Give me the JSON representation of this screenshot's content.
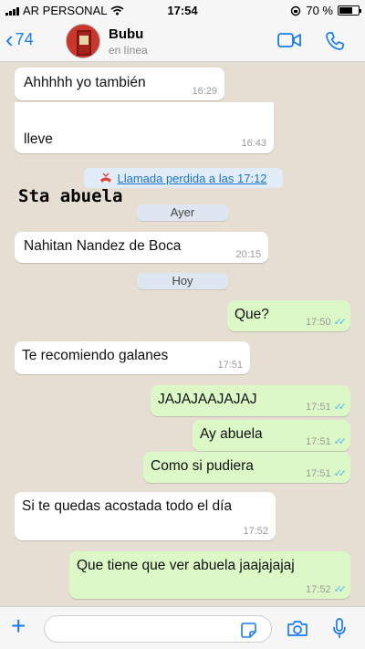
{
  "status_bar": {
    "carrier": "AR PERSONAL",
    "time": "17:54",
    "battery": "70 %",
    "battery_level": 0.7
  },
  "header": {
    "back_count": "74",
    "contact_name": "Bubu",
    "contact_status": "en línea"
  },
  "chat": {
    "overlay_text": "Sta abuela",
    "missed_call": "Llamada perdida a las 17:12",
    "day_yesterday": "Ayer",
    "day_today": "Hoy",
    "messages": [
      {
        "text": "Ahhhhh yo también",
        "time": "16:29"
      },
      {
        "text_line1": "",
        "text_line2": "lleve",
        "time": "16:43"
      },
      {
        "text": "Nahitan Nandez de Boca",
        "time": "20:15"
      },
      {
        "text": "Que?",
        "time": "17:50"
      },
      {
        "text": "Te recomiendo galanes",
        "time": "17:51"
      },
      {
        "text": "JAJAJAAJAJAJ",
        "time": "17:51"
      },
      {
        "text": "Ay abuela",
        "time": "17:51"
      },
      {
        "text": "Como si pudiera",
        "time": "17:51"
      },
      {
        "text": "Si te quedas acostada todo el día",
        "time": "17:52"
      },
      {
        "text": "Que tiene que ver abuela jaajajajaj",
        "time": "17:52"
      }
    ]
  },
  "input": {
    "placeholder": ""
  },
  "icons": [
    "chevron-left-icon",
    "video-icon",
    "phone-icon",
    "plus-icon",
    "sticker-icon",
    "camera-icon",
    "mic-icon",
    "read-ticks-icon",
    "missed-call-icon"
  ],
  "colors": {
    "accent": "#1b7bf2",
    "outgoing": "#dcf8c6",
    "incoming": "#ffffff",
    "ticks": "#4fb6ec"
  }
}
